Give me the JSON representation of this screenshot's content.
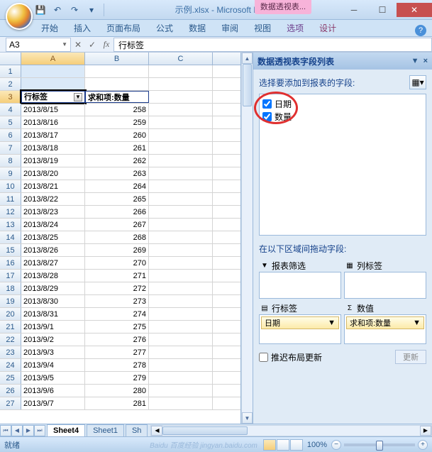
{
  "window": {
    "title": "示例.xlsx - Microsoft Ex...",
    "context_tab": "数据透视表..."
  },
  "ribbon": {
    "tabs": [
      "开始",
      "插入",
      "页面布局",
      "公式",
      "数据",
      "审阅",
      "视图"
    ],
    "context_tabs": [
      "选项",
      "设计"
    ]
  },
  "formula_bar": {
    "name_box": "A3",
    "formula": "行标签"
  },
  "columns": [
    "A",
    "B",
    "C"
  ],
  "header_row": {
    "a": "行标签",
    "b": "求和项:数量"
  },
  "rows": [
    {
      "n": 1,
      "a": "",
      "b": ""
    },
    {
      "n": 2,
      "a": "",
      "b": ""
    },
    {
      "n": 3,
      "a": "行标签",
      "b": "求和项:数量",
      "hdr": true
    },
    {
      "n": 4,
      "a": "2013/8/15",
      "b": "258"
    },
    {
      "n": 5,
      "a": "2013/8/16",
      "b": "259"
    },
    {
      "n": 6,
      "a": "2013/8/17",
      "b": "260"
    },
    {
      "n": 7,
      "a": "2013/8/18",
      "b": "261"
    },
    {
      "n": 8,
      "a": "2013/8/19",
      "b": "262"
    },
    {
      "n": 9,
      "a": "2013/8/20",
      "b": "263"
    },
    {
      "n": 10,
      "a": "2013/8/21",
      "b": "264"
    },
    {
      "n": 11,
      "a": "2013/8/22",
      "b": "265"
    },
    {
      "n": 12,
      "a": "2013/8/23",
      "b": "266"
    },
    {
      "n": 13,
      "a": "2013/8/24",
      "b": "267"
    },
    {
      "n": 14,
      "a": "2013/8/25",
      "b": "268"
    },
    {
      "n": 15,
      "a": "2013/8/26",
      "b": "269"
    },
    {
      "n": 16,
      "a": "2013/8/27",
      "b": "270"
    },
    {
      "n": 17,
      "a": "2013/8/28",
      "b": "271"
    },
    {
      "n": 18,
      "a": "2013/8/29",
      "b": "272"
    },
    {
      "n": 19,
      "a": "2013/8/30",
      "b": "273"
    },
    {
      "n": 20,
      "a": "2013/8/31",
      "b": "274"
    },
    {
      "n": 21,
      "a": "2013/9/1",
      "b": "275"
    },
    {
      "n": 22,
      "a": "2013/9/2",
      "b": "276"
    },
    {
      "n": 23,
      "a": "2013/9/3",
      "b": "277"
    },
    {
      "n": 24,
      "a": "2013/9/4",
      "b": "278"
    },
    {
      "n": 25,
      "a": "2013/9/5",
      "b": "279"
    },
    {
      "n": 26,
      "a": "2013/9/6",
      "b": "280"
    },
    {
      "n": 27,
      "a": "2013/9/7",
      "b": "281"
    }
  ],
  "field_list": {
    "title": "数据透视表字段列表",
    "choose_label": "选择要添加到报表的字段:",
    "fields": [
      {
        "name": "日期",
        "checked": true
      },
      {
        "name": "数量",
        "checked": true
      }
    ],
    "drag_label": "在以下区域间拖动字段:",
    "zones": {
      "filter": {
        "label": "报表筛选",
        "icon": "▼"
      },
      "columns": {
        "label": "列标签",
        "icon": "▦"
      },
      "rows": {
        "label": "行标签",
        "icon": "▤",
        "item": "日期"
      },
      "values": {
        "label": "数值",
        "icon": "Σ",
        "item": "求和项:数量"
      }
    },
    "defer": "推迟布局更新",
    "update": "更新"
  },
  "sheet_tabs": {
    "active": "Sheet4",
    "others": [
      "Sheet1",
      "Sh"
    ]
  },
  "statusbar": {
    "ready": "就绪",
    "zoom": "100%",
    "watermark": "Baidu 百度经验 jingyan.baidu.com"
  }
}
